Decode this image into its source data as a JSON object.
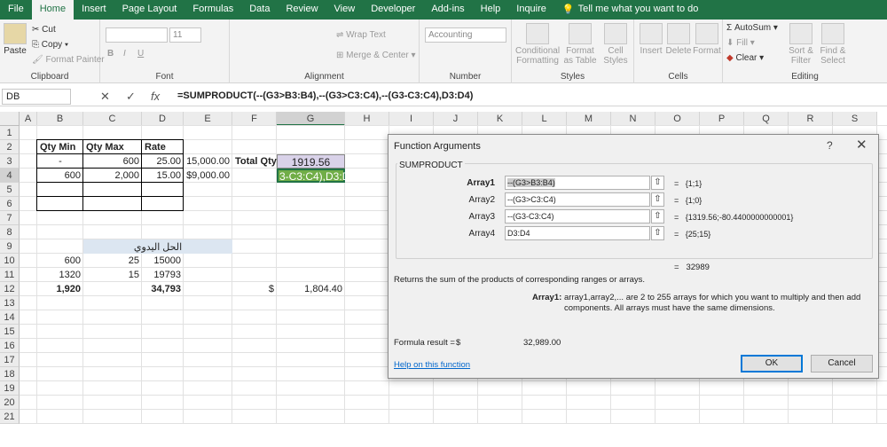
{
  "tabs": [
    "File",
    "Home",
    "Insert",
    "Page Layout",
    "Formulas",
    "Data",
    "Review",
    "View",
    "Developer",
    "Add-ins",
    "Help",
    "Inquire"
  ],
  "tell_me": "Tell me what you want to do",
  "ribbon": {
    "clipboard": {
      "paste": "Paste",
      "cut": "Cut",
      "copy": "Copy",
      "format_painter": "Format Painter",
      "label": "Clipboard"
    },
    "font": {
      "size": "11",
      "label": "Font",
      "bold": "B",
      "italic": "I",
      "underline": "U"
    },
    "alignment": {
      "wrap": "Wrap Text",
      "merge": "Merge & Center",
      "label": "Alignment"
    },
    "number": {
      "format": "Accounting",
      "label": "Number"
    },
    "styles": {
      "conditional": "Conditional Formatting",
      "format_table": "Format as Table",
      "cell_styles": "Cell Styles",
      "label": "Styles"
    },
    "cells": {
      "insert": "Insert",
      "delete": "Delete",
      "format": "Format",
      "label": "Cells"
    },
    "editing": {
      "autosum": "AutoSum",
      "fill": "Fill",
      "clear": "Clear",
      "sort": "Sort & Filter",
      "find": "Find & Select",
      "label": "Editing"
    }
  },
  "name_box": "DB",
  "fx": "fx",
  "formula": "=SUMPRODUCT(--(G3>B3:B4),--(G3>C3:C4),--(G3-C3:C4),D3:D4)",
  "columns": [
    "A",
    "B",
    "C",
    "D",
    "E",
    "F",
    "G",
    "H",
    "I",
    "J",
    "K",
    "L",
    "M",
    "N",
    "O",
    "P",
    "Q",
    "R",
    "S"
  ],
  "rows": [
    "1",
    "2",
    "3",
    "4",
    "5",
    "6",
    "7",
    "8",
    "9",
    "10",
    "11",
    "12",
    "13",
    "14",
    "15",
    "16",
    "17",
    "18",
    "19",
    "20",
    "21"
  ],
  "cells": {
    "b2": "Qty  Min",
    "c2": "Qty  Max",
    "d2": "Rate",
    "b3": "-",
    "c3": "600",
    "d3": "25.00",
    "e3": "15,000.00",
    "f3": "Total Qty",
    "g3": "1919.56",
    "b4": "600",
    "c4": "2,000",
    "d4": "15.00",
    "e4": "$9,000.00",
    "g4": "3-C3:C4),D3:D4)",
    "c9": "الحل اليدوي",
    "b10": "600",
    "c10": "25",
    "d10": "15000",
    "b11": "1320",
    "c11": "15",
    "d11": "19793",
    "b12": "1,920",
    "d12": "34,793",
    "f12": "$",
    "g12": "1,804.40"
  },
  "dialog": {
    "title": "Function Arguments",
    "help_q": "?",
    "close": "✕",
    "fn": "SUMPRODUCT",
    "args": [
      {
        "label": "Array1",
        "value": "--(G3>B3:B4)",
        "result": "{1;1}"
      },
      {
        "label": "Array2",
        "value": "--(G3>C3:C4)",
        "result": "{1;0}"
      },
      {
        "label": "Array3",
        "value": "--(G3-C3:C4)",
        "result": "{1319.56;-80.4400000000001}"
      },
      {
        "label": "Array4",
        "value": "D3:D4",
        "result": "{25;15}"
      }
    ],
    "eq": "=",
    "total": "32989",
    "description": "Returns the sum of the products of corresponding ranges or arrays.",
    "arg_name": "Array1:",
    "arg_desc": "array1,array2,... are 2 to 255 arrays for which you want to multiply and then add components. All arrays must have the same dimensions.",
    "formula_result_label": "Formula result =",
    "formula_result_currency": "$",
    "formula_result_value": "32,989.00",
    "help_link": "Help on this function",
    "ok": "OK",
    "cancel": "Cancel"
  }
}
